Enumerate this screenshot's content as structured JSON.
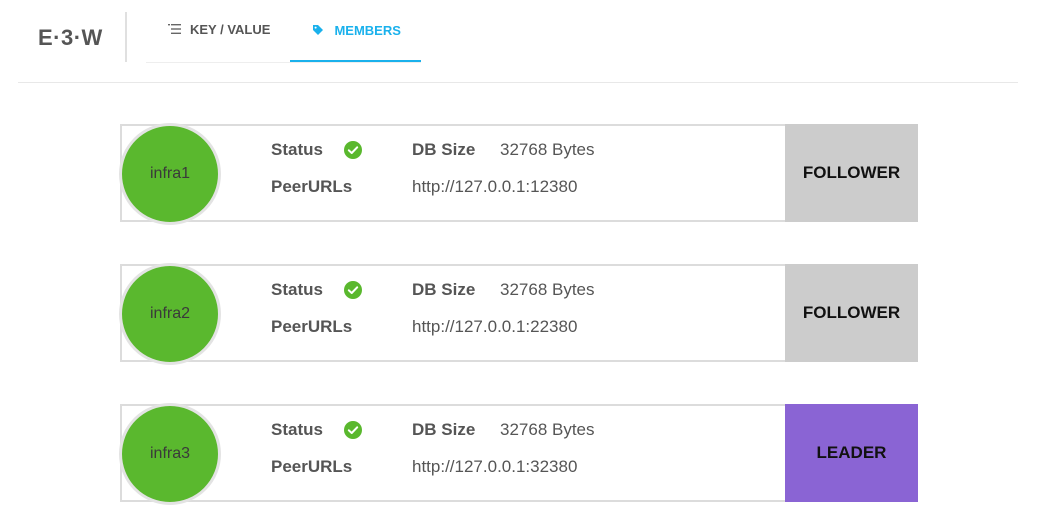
{
  "app": {
    "logo": "E·3·W"
  },
  "tabs": [
    {
      "label": "KEY / VALUE",
      "icon": "list-icon",
      "active": false
    },
    {
      "label": "MEMBERS",
      "icon": "tag-icon",
      "active": true
    }
  ],
  "colors": {
    "accent": "#1ab1ec",
    "avatar_healthy": "#5ab82e",
    "follower": "#cccccc",
    "leader": "#8a64d4",
    "status_ok": "#5ab82e"
  },
  "members": [
    {
      "name": "infra1",
      "status_label": "Status",
      "status_icon": "check-circle-icon",
      "db_size_label": "DB Size",
      "db_size": "32768 Bytes",
      "peer_urls_label": "PeerURLs",
      "peer_urls": "http://127.0.0.1:12380",
      "role": "FOLLOWER"
    },
    {
      "name": "infra2",
      "status_label": "Status",
      "status_icon": "check-circle-icon",
      "db_size_label": "DB Size",
      "db_size": "32768 Bytes",
      "peer_urls_label": "PeerURLs",
      "peer_urls": "http://127.0.0.1:22380",
      "role": "FOLLOWER"
    },
    {
      "name": "infra3",
      "status_label": "Status",
      "status_icon": "check-circle-icon",
      "db_size_label": "DB Size",
      "db_size": "32768 Bytes",
      "peer_urls_label": "PeerURLs",
      "peer_urls": "http://127.0.0.1:32380",
      "role": "LEADER"
    }
  ]
}
